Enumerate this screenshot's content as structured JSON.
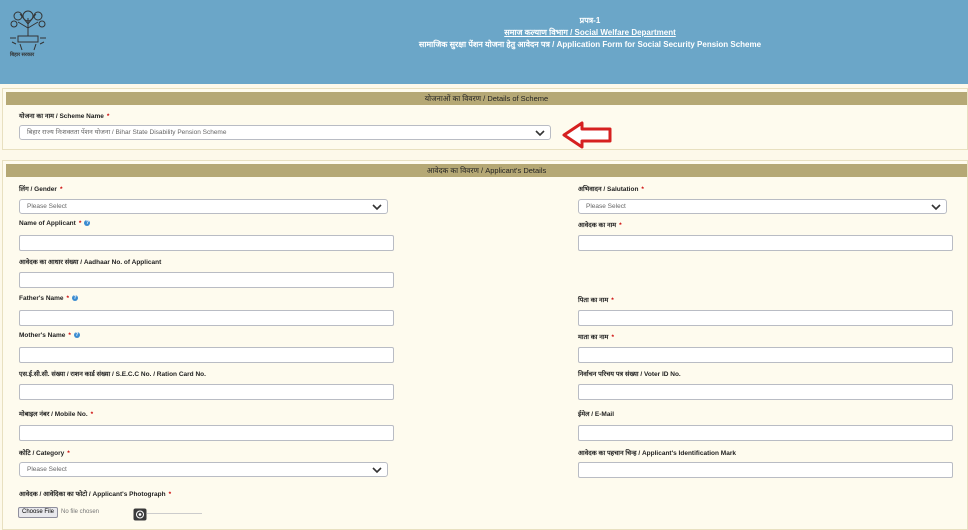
{
  "header": {
    "form_no": "प्रपत्र-1",
    "department": "समाज कल्याण विभाग / Social Welfare Department",
    "form_title": "सामाजिक सुरक्षा पेंशन योजना हेतु आवेदन पत्र / Application Form for Social Security Pension Scheme",
    "logo_caption": "बिहार सरकार"
  },
  "scheme_section": {
    "title": "योजनाओं का विवरण / Details of Scheme",
    "scheme_label": "योजना का नाम / Scheme Name",
    "scheme_value": "बिहार राज्य निःशक्तता पेंशन योजना / Bihar State Disability Pension Scheme"
  },
  "applicant_section": {
    "title": "आवेदक का विवरण / Applicant's Details",
    "gender_label": "लिंग / Gender",
    "gender_value": "Please Select",
    "salutation_label": "अभिवादन / Salutation",
    "salutation_value": "Please Select",
    "name_label": "Name of Applicant",
    "name_hindi_label": "आवेदक का नाम",
    "aadhaar_label": "आवेदक का आधार संख्या / Aadhaar No. of Applicant",
    "father_label": "Father's Name",
    "father_hindi_label": "पिता का नाम",
    "mother_label": "Mother's Name",
    "mother_hindi_label": "माता का नाम",
    "secc_label": "एस.ई.सी.सी. संख्या / राशन कार्ड संख्या / S.E.C.C No. / Ration Card No.",
    "voter_label": "निर्वाचन परिचय पत्र संख्या / Voter ID No.",
    "mobile_label": "मोबाइल नंबर / Mobile No.",
    "email_label": "ईमेल / E-Mail",
    "category_label": "कोटि / Category",
    "category_value": "Please Select",
    "id_mark_label": "आवेदक का पहचान चिन्ह / Applicant's Identification Mark",
    "photo_label": "आवेदक / आवेदिका का फोटो / Applicant's Photograph",
    "choose_file": "Choose File",
    "no_file": "No file chosen"
  },
  "required_mark": "*",
  "info_icon_glyph": "?",
  "colors": {
    "header_bg": "#6ba6c8",
    "section_bar": "#b5a875",
    "arrow": "#d62020",
    "page_bg": "#fdf9ea"
  }
}
